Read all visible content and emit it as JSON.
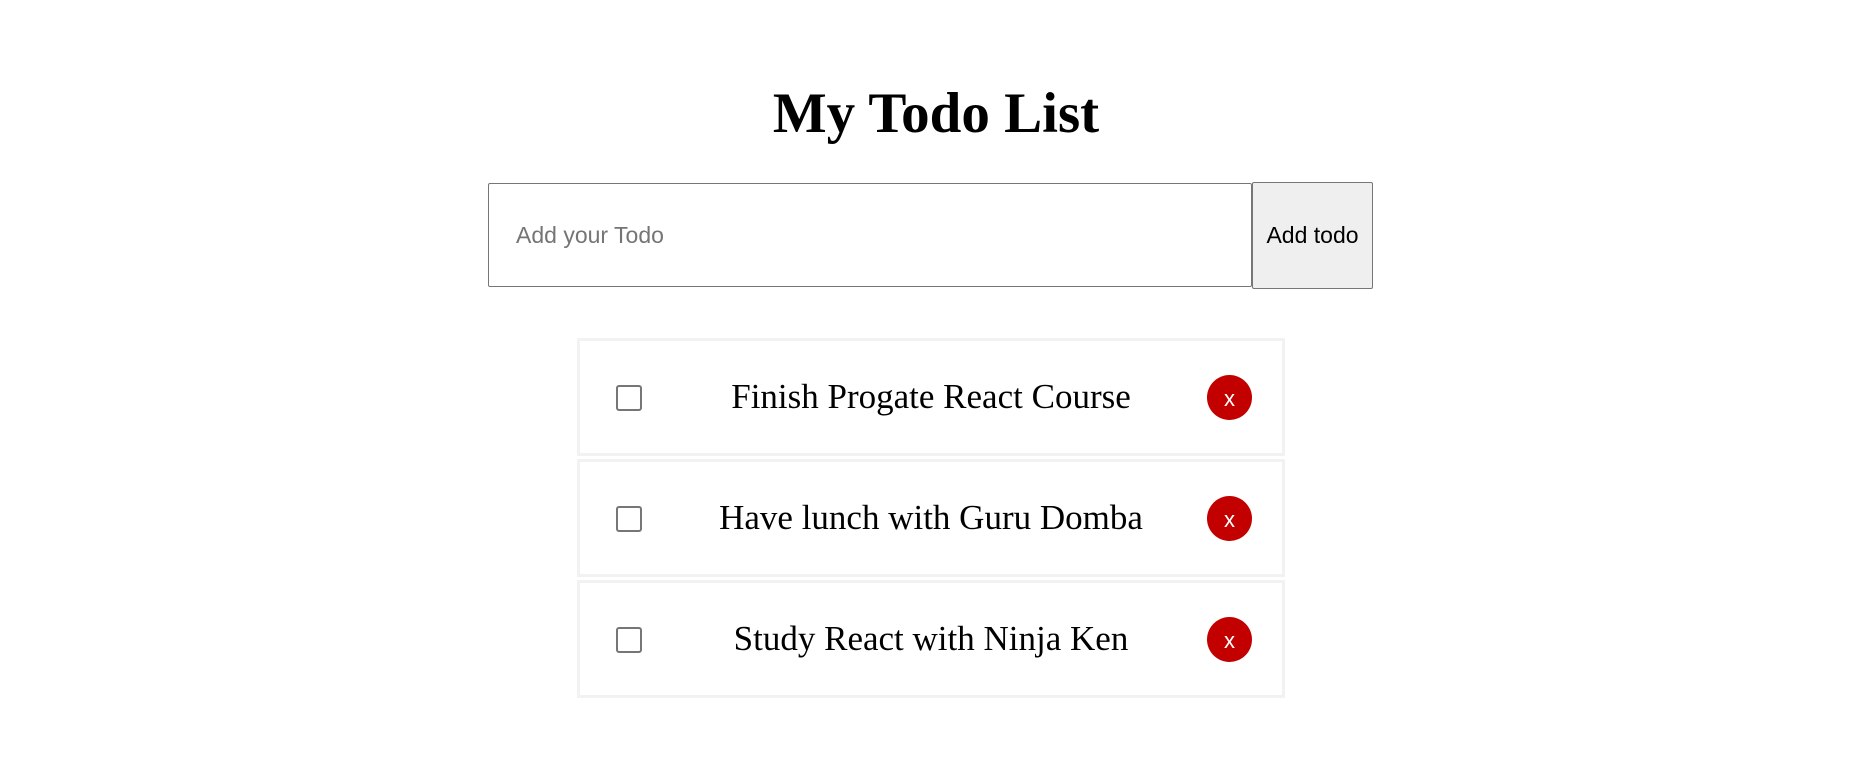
{
  "title": "My Todo List",
  "form": {
    "placeholder": "Add your Todo",
    "value": "",
    "add_label": "Add todo"
  },
  "todos": [
    {
      "text": "Finish Progate React Course",
      "done": false,
      "delete_label": "x"
    },
    {
      "text": "Have lunch with Guru Domba",
      "done": false,
      "delete_label": "x"
    },
    {
      "text": "Study React with Ninja Ken",
      "done": false,
      "delete_label": "x"
    }
  ],
  "colors": {
    "delete_button": "#c20000",
    "add_button_bg": "#efefef",
    "item_border": "#f2f2f2"
  }
}
